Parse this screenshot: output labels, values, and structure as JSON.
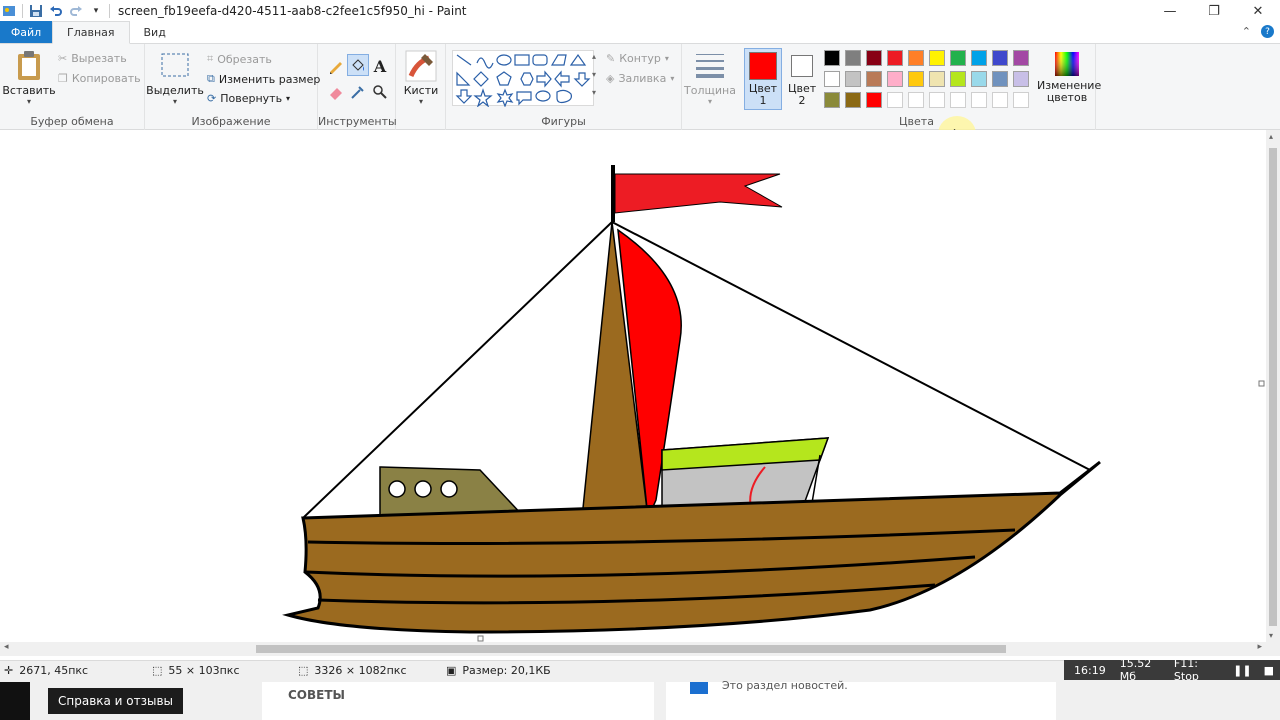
{
  "window": {
    "title": "screen_fb19eefa-d420-4511-aab8-c2fee1c5f950_hi - Paint"
  },
  "tabs": [
    {
      "label": "Файл"
    },
    {
      "label": "Главная"
    },
    {
      "label": "Вид"
    }
  ],
  "ribbon": {
    "clipboard": {
      "label": "Буфер обмена",
      "paste": "Вставить",
      "cut": "Вырезать",
      "copy": "Копировать"
    },
    "image": {
      "label": "Изображение",
      "select": "Выделить",
      "crop": "Обрезать",
      "resize": "Изменить размер",
      "rotate": "Повернуть"
    },
    "tools": {
      "label": "Инструменты"
    },
    "brushes": {
      "label": "Кисти"
    },
    "shapes": {
      "label": "Фигуры",
      "outline": "Контур",
      "fill": "Заливка"
    },
    "size": {
      "label": "Толщина"
    },
    "colors": {
      "label": "Цвета",
      "color1": "Цвет 1",
      "color2": "Цвет 2",
      "edit": "Изменение цветов",
      "color1_value": "#ff0000",
      "color2_value": "#ffffff",
      "palette_row1": [
        "#000000",
        "#7f7f7f",
        "#880015",
        "#ed1c24",
        "#ff7f27",
        "#fff200",
        "#22b14c",
        "#00a2e8",
        "#3f48cc",
        "#a349a4"
      ],
      "palette_row2": [
        "#ffffff",
        "#c3c3c3",
        "#b97a57",
        "#ffaec9",
        "#ffc90e",
        "#efe4b0",
        "#b5e61d",
        "#99d9ea",
        "#7092be",
        "#c8bfe7"
      ],
      "palette_row3": [
        "#8a8a3a",
        "#8b6914",
        "#ff0000"
      ]
    }
  },
  "status": {
    "cursor": "2671, 45пкс",
    "selection": "55 × 103пкс",
    "image_size": "3326 × 1082пкс",
    "file_size": "Размер: 20,1КБ"
  },
  "recorder": {
    "time": "16:19",
    "memory": "15.52 Мб",
    "stop": "F11: Stop"
  },
  "browser": {
    "help": "Справка и отзывы",
    "tips": "СОВЕТЫ",
    "news": "Это раздел новостей."
  }
}
